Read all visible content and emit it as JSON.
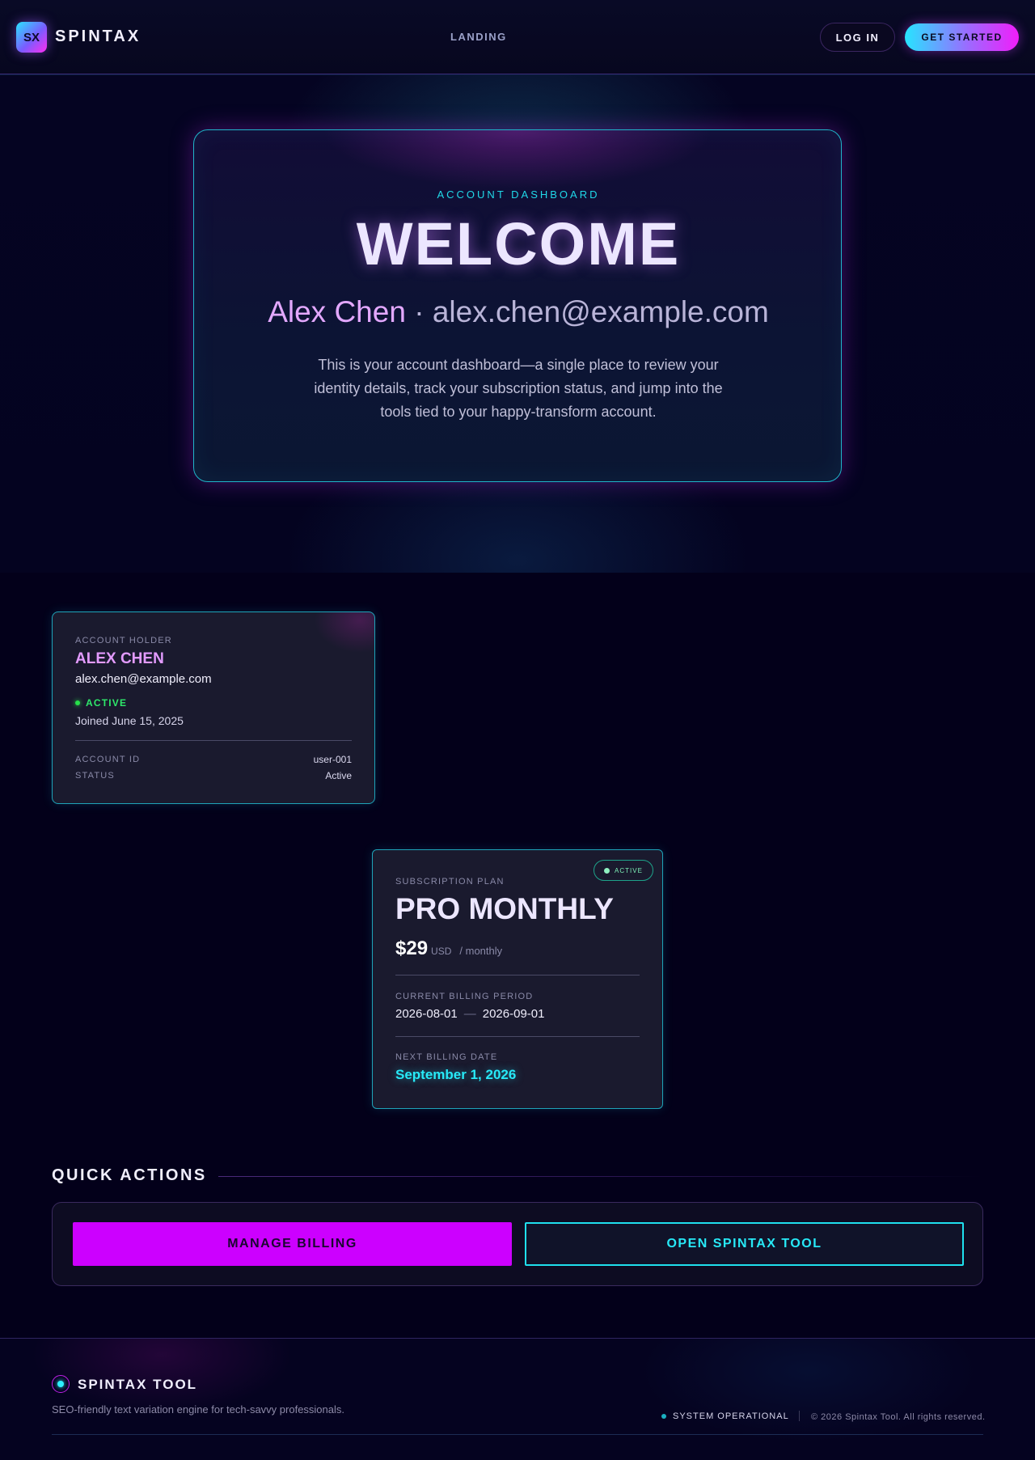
{
  "nav": {
    "logo_badge": "SX",
    "logo_text": "SPINTAX",
    "link_landing": "LANDING",
    "login_label": "LOG IN",
    "get_started_label": "GET STARTED"
  },
  "hero": {
    "eyebrow": "ACCOUNT DASHBOARD",
    "title": "WELCOME",
    "user_name": "Alex Chen",
    "separator": " · ",
    "user_email": "alex.chen@example.com",
    "description": "This is your account dashboard—a single place to review your identity details, track your subscription status, and jump into the tools tied to your happy-transform account."
  },
  "account_card": {
    "eyebrow": "ACCOUNT HOLDER",
    "name": "ALEX CHEN",
    "email": "alex.chen@example.com",
    "status": "ACTIVE",
    "joined": "Joined June 15, 2025",
    "rows": [
      {
        "label": "ACCOUNT ID",
        "value": "user-001"
      },
      {
        "label": "STATUS",
        "value": "Active"
      }
    ]
  },
  "subscription_card": {
    "badge": "ACTIVE",
    "eyebrow": "SUBSCRIPTION PLAN",
    "plan": "PRO MONTHLY",
    "price": "$29",
    "currency": "USD",
    "interval": "/ monthly",
    "period_label": "CURRENT BILLING PERIOD",
    "period_start": "2026-08-01",
    "period_sep": "—",
    "period_end": "2026-09-01",
    "next_label": "NEXT BILLING DATE",
    "next_date": "September 1, 2026"
  },
  "quick_actions": {
    "title": "QUICK ACTIONS",
    "manage_billing": "MANAGE BILLING",
    "open_tool": "OPEN SPINTAX TOOL"
  },
  "footer": {
    "brand": "SPINTAX TOOL",
    "tagline": "SEO-friendly text variation engine for tech-savvy professionals.",
    "system_status": "SYSTEM OPERATIONAL",
    "copyright": "© 2026 Spintax Tool. All rights reserved."
  },
  "colors": {
    "accent_cyan": "#27e9f7",
    "accent_magenta": "#cc00ff",
    "status_green": "#2ee86a",
    "background": "#03001a"
  }
}
